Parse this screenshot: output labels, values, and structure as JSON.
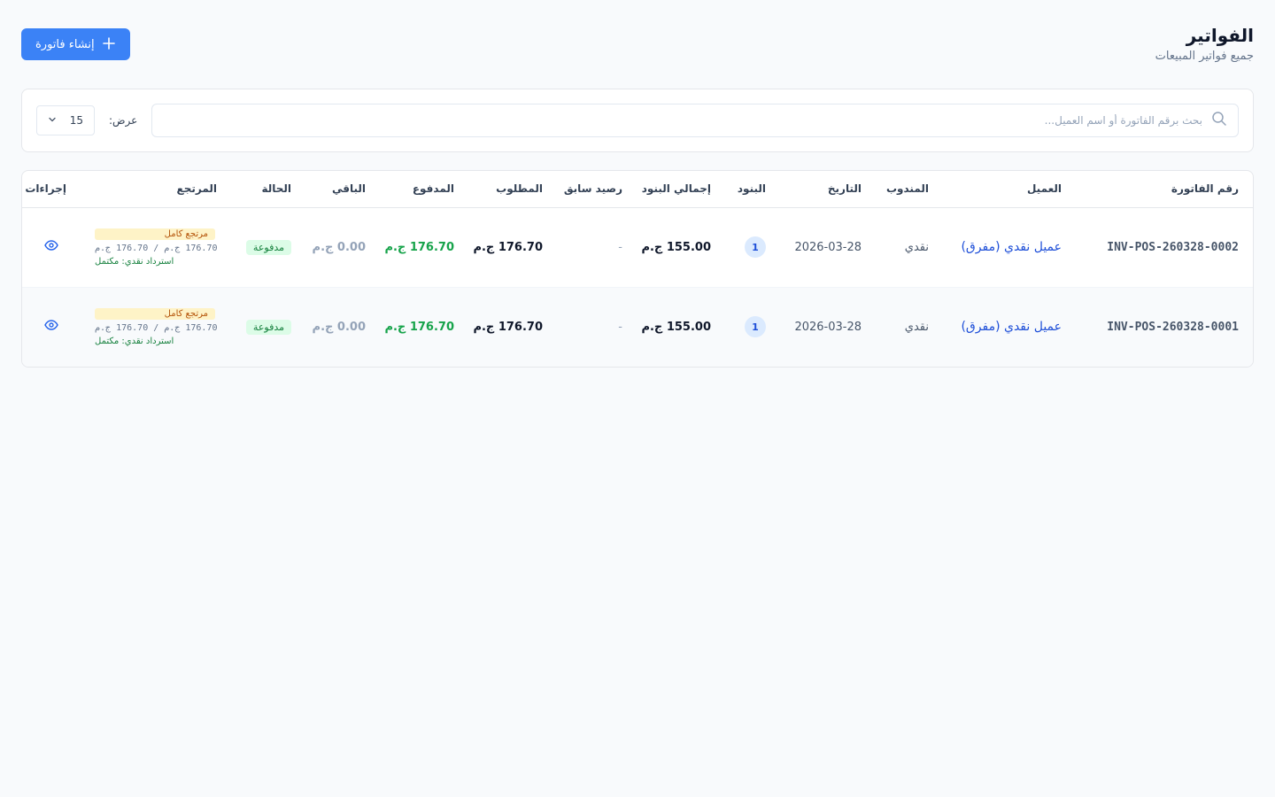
{
  "header": {
    "title": "الفواتير",
    "subtitle": "جميع فواتير المبيعات",
    "create_button": "إنشاء فاتورة"
  },
  "filters": {
    "search_placeholder": "بحث برقم الفاتورة أو اسم العميل...",
    "search_value": "",
    "show_label": "عرض:",
    "page_size": "15"
  },
  "table": {
    "columns": {
      "invoice_no": "رقم الفاتورة",
      "customer": "العميل",
      "rep": "المندوب",
      "date": "التاريخ",
      "items": "البنود",
      "items_total": "إجمالي البنود",
      "prev_balance": "رصيد سابق",
      "required": "المطلوب",
      "paid": "المدفوع",
      "remaining": "الباقي",
      "status": "الحالة",
      "returned": "المرتجع",
      "actions": "إجراءات"
    },
    "rows": [
      {
        "invoice_no": "INV-POS-260328-0002",
        "customer": "عميل نقدي (مفرق)",
        "rep": "نقدي",
        "date": "2026-03-28",
        "items": "1",
        "items_total": "155.00 ج.م",
        "prev_balance": "-",
        "required": "176.70 ج.م",
        "paid": "176.70 ج.م",
        "remaining": "0.00 ج.م",
        "status": "مدفوعة",
        "return_badge": "مرتجع كامل",
        "return_amount": "176.70 ج.م / 176.70 ج.م",
        "return_note": "استرداد نقدي: مكتمل"
      },
      {
        "invoice_no": "INV-POS-260328-0001",
        "customer": "عميل نقدي (مفرق)",
        "rep": "نقدي",
        "date": "2026-03-28",
        "items": "1",
        "items_total": "155.00 ج.م",
        "prev_balance": "-",
        "required": "176.70 ج.م",
        "paid": "176.70 ج.م",
        "remaining": "0.00 ج.م",
        "status": "مدفوعة",
        "return_badge": "مرتجع كامل",
        "return_amount": "176.70 ج.م / 176.70 ج.م",
        "return_note": "استرداد نقدي: مكتمل"
      }
    ]
  },
  "icons": {
    "search": "search-icon",
    "plus": "plus-icon",
    "chevron": "chevron-down-icon",
    "view": "eye-icon"
  },
  "colors": {
    "primary": "#3b82f6",
    "link": "#1d4ed8",
    "paid": "#16a34a",
    "status_bg": "#dcfce7",
    "return_bg": "#fef3c7",
    "return_text": "#b45309"
  }
}
